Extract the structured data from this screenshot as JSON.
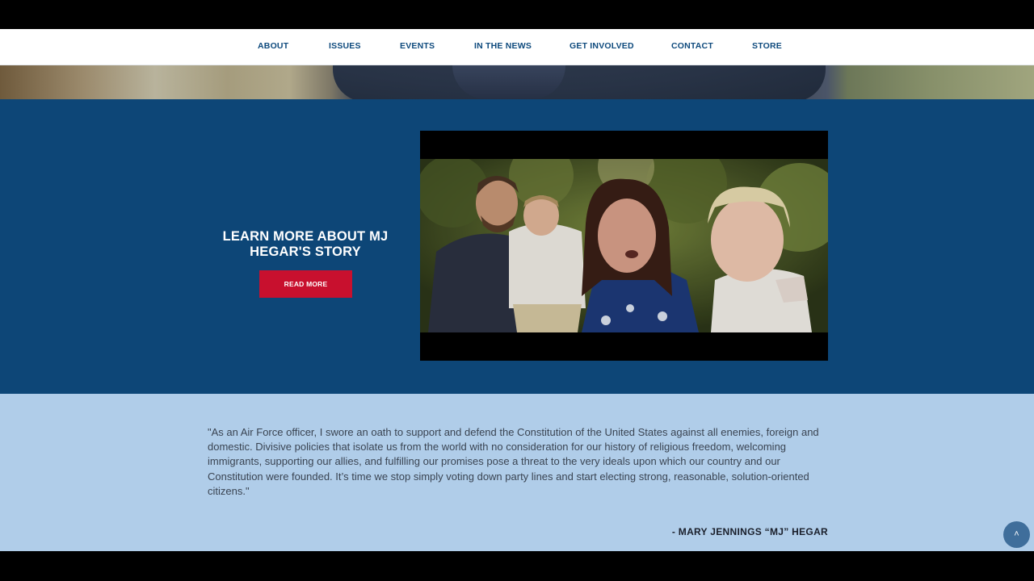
{
  "nav": {
    "items": [
      {
        "label": "ABOUT"
      },
      {
        "label": "ISSUES"
      },
      {
        "label": "EVENTS"
      },
      {
        "label": "IN THE NEWS"
      },
      {
        "label": "GET INVOLVED"
      },
      {
        "label": "CONTACT"
      },
      {
        "label": "STORE"
      }
    ]
  },
  "story": {
    "title": "LEARN MORE ABOUT MJ HEGAR'S STORY",
    "button_label": "READ MORE"
  },
  "quote": {
    "text": "\"As an Air Force officer, I swore an oath to support and defend the Constitution of the United States against all enemies, foreign and domestic. Divisive policies that isolate us from the world with no consideration for our history of religious freedom, welcoming immigrants, supporting our allies, and fulfilling our promises pose a threat to the very ideals upon which our country and our Constitution were founded. It’s time we stop simply voting down party lines and start electing strong, reasonable, solution-oriented citizens.\"",
    "author": "- MARY JENNINGS “MJ” HEGAR"
  },
  "colors": {
    "nav_text": "#0e4a7d",
    "story_bg": "#0d4677",
    "button_red": "#c8102e",
    "quote_bg": "#b0cde9"
  },
  "icons": {
    "back_to_top": "chevron-up-icon"
  }
}
